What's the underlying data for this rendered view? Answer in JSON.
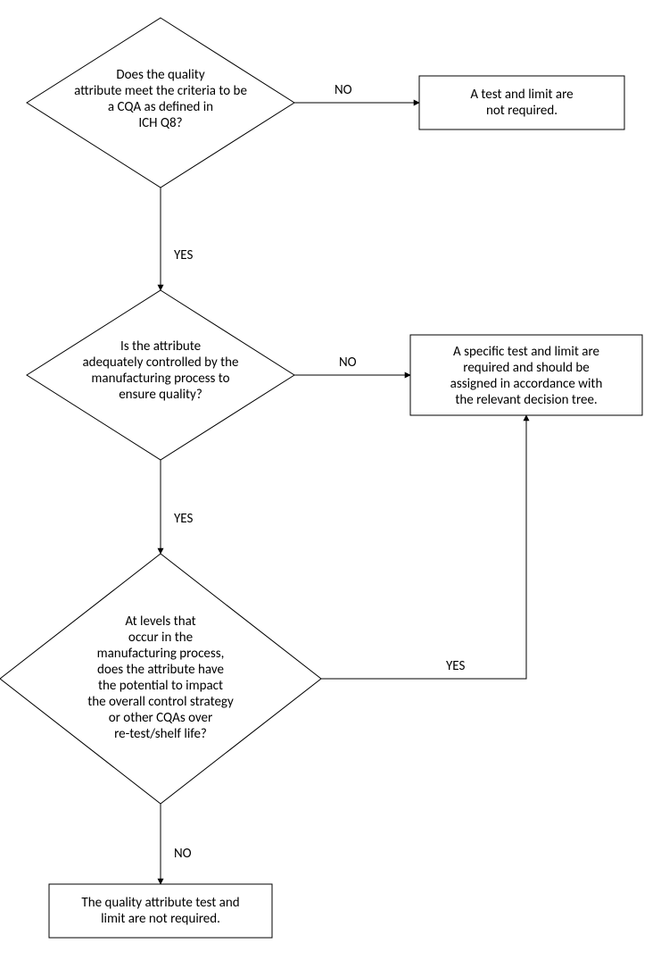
{
  "nodes": {
    "d1": {
      "lines": [
        "Does the quality",
        "attribute meet the criteria to be",
        "a CQA as defined in",
        "ICH Q8?"
      ]
    },
    "d2": {
      "lines": [
        "Is the attribute",
        "adequately controlled by the",
        "manufacturing process to",
        "ensure quality?"
      ]
    },
    "d3": {
      "lines": [
        "At levels that",
        "occur in the",
        "manufacturing process,",
        "does the attribute have",
        "the potential to impact",
        "the overall control strategy",
        "or other CQAs over",
        "re-test/shelf life?"
      ]
    },
    "r1": {
      "lines": [
        "A test and limit are",
        "not required."
      ]
    },
    "r2": {
      "lines": [
        "A specific test and limit are",
        "required and should be",
        "assigned in accordance with",
        "the relevant decision tree."
      ]
    },
    "r3": {
      "lines": [
        "The quality attribute test and",
        "limit are not required."
      ]
    }
  },
  "edges": {
    "d1_no": "NO",
    "d1_yes": "YES",
    "d2_no": "NO",
    "d2_yes": "YES",
    "d3_yes": "YES",
    "d3_no": "NO"
  }
}
